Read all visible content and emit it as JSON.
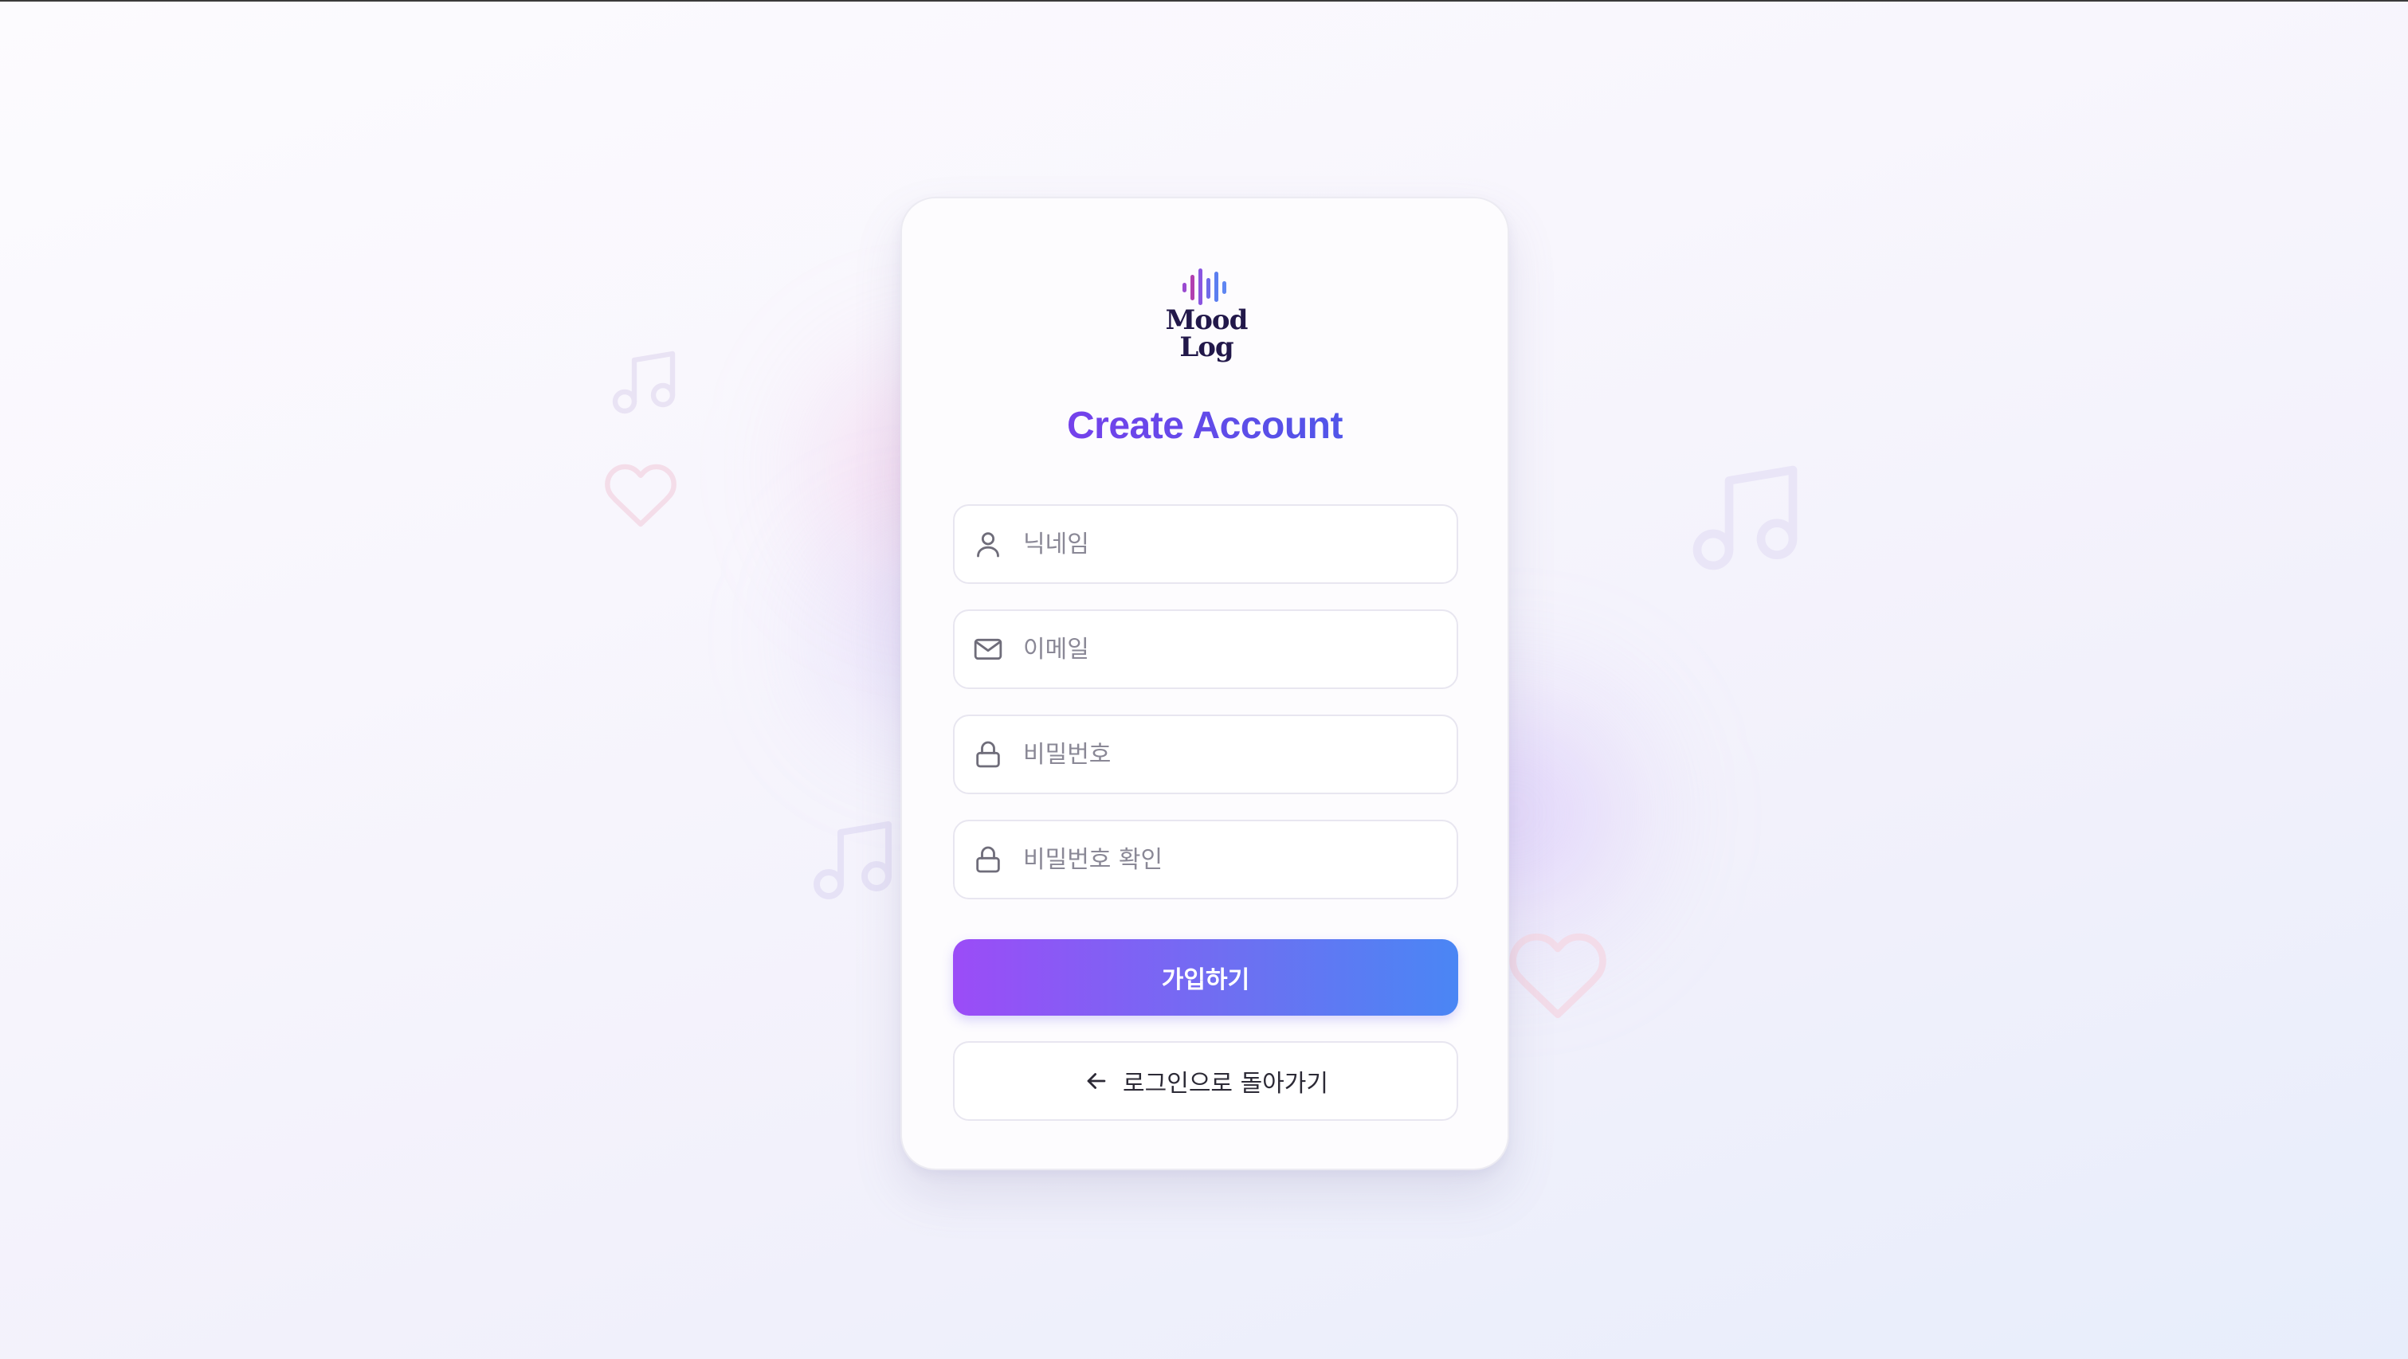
{
  "app": {
    "logo_line1": "Mood",
    "logo_line2": "Log"
  },
  "form": {
    "title": "Create Account",
    "nickname_placeholder": "닉네임",
    "email_placeholder": "이메일",
    "password_placeholder": "비밀번호",
    "password_confirm_placeholder": "비밀번호 확인",
    "nickname_value": "",
    "email_value": "",
    "password_value": "",
    "password_confirm_value": "",
    "submit_label": "가입하기",
    "back_label": "로그인으로 돌아가기"
  },
  "icons": {
    "nickname": "user-icon",
    "email": "mail-icon",
    "password": "lock-icon",
    "password_confirm": "lock-icon",
    "back": "arrow-left-icon",
    "decorations": [
      "music-note-icon",
      "heart-icon"
    ]
  },
  "colors": {
    "title_gradient": [
      "#8b36ee",
      "#3e63ec"
    ],
    "button_gradient": [
      "#9b4cf7",
      "#4a86f4"
    ],
    "logo_text": "#22184a",
    "background": "#f8f6fd"
  }
}
